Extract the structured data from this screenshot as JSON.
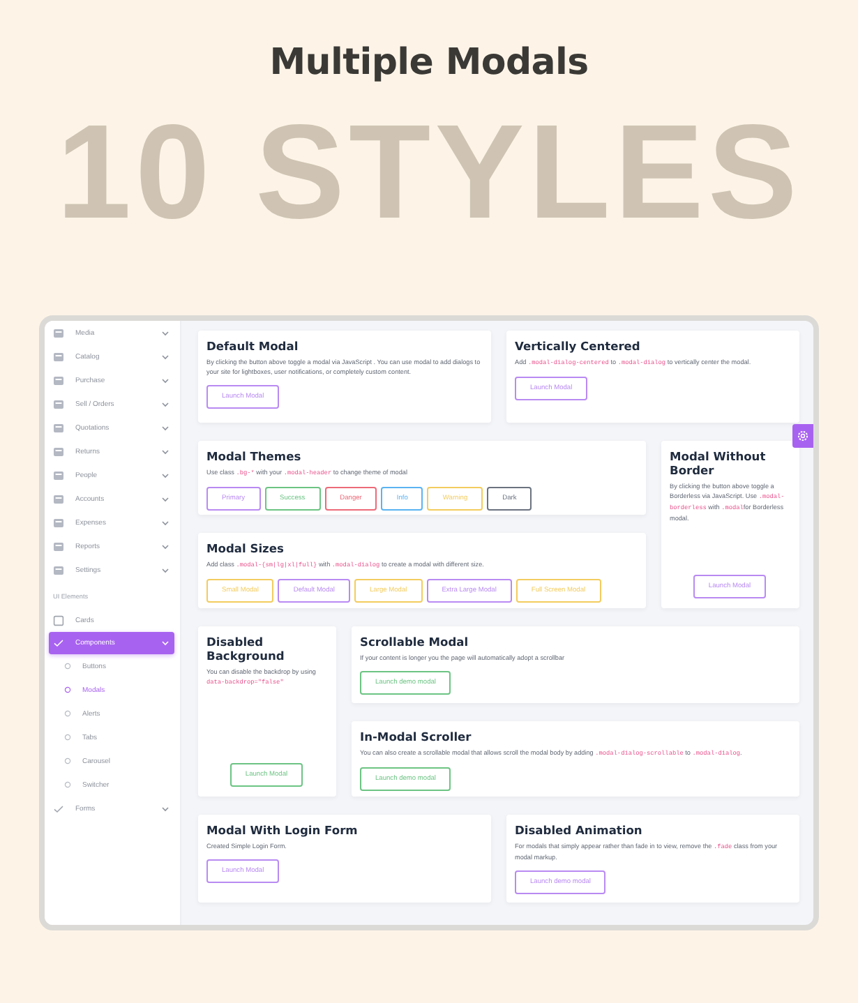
{
  "page": {
    "title": "Multiple Modals",
    "banner": "10 STYLES"
  },
  "sidebar": {
    "items": [
      {
        "label": "Media",
        "selected": false
      },
      {
        "label": "Catalog",
        "selected": false
      },
      {
        "label": "Purchase",
        "selected": false
      },
      {
        "label": "Sell / Orders",
        "selected": false
      },
      {
        "label": "Quotations",
        "selected": false
      },
      {
        "label": "Returns",
        "selected": false
      },
      {
        "label": "People",
        "selected": false
      },
      {
        "label": "Accounts",
        "selected": false
      },
      {
        "label": "Expenses",
        "selected": false
      },
      {
        "label": "Reports",
        "selected": false
      },
      {
        "label": "Settings",
        "selected": false
      }
    ],
    "section_label": "UI Elements",
    "ui_items": [
      {
        "kind": "page",
        "label": "Cards",
        "selected": false,
        "expandable": false
      },
      {
        "kind": "group",
        "label": "Components",
        "selected": true,
        "expandable": true,
        "children": [
          {
            "label": "Buttons",
            "selected": false
          },
          {
            "label": "Modals",
            "selected": true
          },
          {
            "label": "Alerts",
            "selected": false
          },
          {
            "label": "Tabs",
            "selected": false
          },
          {
            "label": "Carousel",
            "selected": false
          },
          {
            "label": "Switcher",
            "selected": false
          }
        ]
      },
      {
        "kind": "group",
        "label": "Forms",
        "selected": false,
        "expandable": true
      }
    ]
  },
  "cards": [
    {
      "title": "Default Modal",
      "description": [
        {
          "text": "By clicking the button above toggle a modal via JavaScript . You can use modal to add dialogs to your site for lightboxes, user notifications, or completely custom content.",
          "code": false
        }
      ],
      "buttons": [
        {
          "label": "Launch Modal",
          "color": "#b98af2"
        }
      ]
    },
    {
      "title": "Vertically Centered",
      "description": [
        {
          "text": "Add ",
          "code": false
        },
        {
          "text": ".modal-dialog-centered",
          "code": true
        },
        {
          "text": " to ",
          "code": false
        },
        {
          "text": ".modal-dialog",
          "code": true
        },
        {
          "text": " to vertically center the modal.",
          "code": false
        }
      ],
      "buttons": [
        {
          "label": "Launch Modal",
          "color": "#b98af2"
        }
      ]
    },
    {
      "title": "Modal Themes",
      "description": [
        {
          "text": "Use class ",
          "code": false
        },
        {
          "text": ".bg-*",
          "code": true
        },
        {
          "text": " with your ",
          "code": false
        },
        {
          "text": ".modal-header",
          "code": true
        },
        {
          "text": " to change theme of modal",
          "code": false
        }
      ],
      "buttons": [
        {
          "label": "Primary",
          "color": "#b98af2"
        },
        {
          "label": "Success",
          "color": "#6cc483"
        },
        {
          "label": "Danger",
          "color": "#ec6a78"
        },
        {
          "label": "Info",
          "color": "#5ab3f2"
        },
        {
          "label": "Warning",
          "color": "#f3cc5e"
        },
        {
          "label": "Dark",
          "color": "#6b7380"
        }
      ]
    },
    {
      "title": "Modal Without Border",
      "description": [
        {
          "text": "By clicking the button above toggle a Borderless via JavaScript. Use ",
          "code": false
        },
        {
          "text": ".modal-borderless",
          "code": true
        },
        {
          "text": " with ",
          "code": false
        },
        {
          "text": ".modal",
          "code": true
        },
        {
          "text": "for Borderless modal.",
          "code": false
        }
      ],
      "buttons": [
        {
          "label": "Launch Modal",
          "color": "#b98af2"
        }
      ]
    },
    {
      "title": "Modal Sizes",
      "description": [
        {
          "text": "Add class ",
          "code": false
        },
        {
          "text": ".modal-{sm|lg|xl|full}",
          "code": true
        },
        {
          "text": " with ",
          "code": false
        },
        {
          "text": ".modal-dialog",
          "code": true
        },
        {
          "text": " to create a modal with different size.",
          "code": false
        }
      ],
      "buttons": [
        {
          "label": "Small Modal",
          "color": "#f3cc5e"
        },
        {
          "label": "Default Modal",
          "color": "#b98af2"
        },
        {
          "label": "Large Modal",
          "color": "#f3cc5e"
        },
        {
          "label": "Extra Large Modal",
          "color": "#b98af2"
        },
        {
          "label": "Full Screen Modal",
          "color": "#f3cc5e"
        }
      ]
    },
    {
      "title": "Disabled Background",
      "description": [
        {
          "text": "You can disable the backdrop by using ",
          "code": false
        },
        {
          "text": "data-backdrop=\"false\"",
          "code": true
        }
      ],
      "buttons": [
        {
          "label": "Launch Modal",
          "color": "#6cc483"
        }
      ]
    },
    {
      "title": "Scrollable Modal",
      "description": [
        {
          "text": "If your content is longer you the page will automatically adopt a scrollbar",
          "code": false
        }
      ],
      "buttons": [
        {
          "label": "Launch demo modal",
          "color": "#6cc483"
        }
      ]
    },
    {
      "title": "In-Modal Scroller",
      "description": [
        {
          "text": "You can also create a scrollable modal that allows scroll the modal body by adding ",
          "code": false
        },
        {
          "text": ".modal-dialog-scrollable",
          "code": true
        },
        {
          "text": " to ",
          "code": false
        },
        {
          "text": ".modal-dialog",
          "code": true
        },
        {
          "text": ".",
          "code": false
        }
      ],
      "buttons": [
        {
          "label": "Launch demo modal",
          "color": "#6cc483"
        }
      ]
    },
    {
      "title": "Modal With Login Form",
      "description": [
        {
          "text": "Created Simple Login Form.",
          "code": false
        }
      ],
      "buttons": [
        {
          "label": "Launch Modal",
          "color": "#b98af2"
        }
      ]
    },
    {
      "title": "Disabled Animation",
      "description": [
        {
          "text": "For modals that simply appear rather than fade in to view, remove the ",
          "code": false
        },
        {
          "text": ".fade",
          "code": true
        },
        {
          "text": " class from your modal markup.",
          "code": false
        }
      ],
      "buttons": [
        {
          "label": "Launch demo modal",
          "color": "#b98af2"
        }
      ]
    }
  ]
}
